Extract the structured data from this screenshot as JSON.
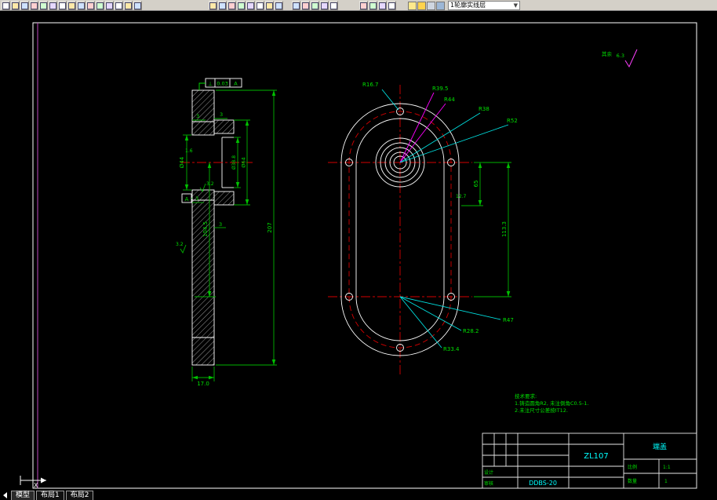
{
  "toolbar": {
    "groups": [
      {
        "name": "standard",
        "icons": [
          "new-file",
          "open-file",
          "save",
          "plot",
          "plot-preview",
          "spell-check",
          "cut",
          "copy",
          "paste",
          "match-properties",
          "undo",
          "redo",
          "insert-block",
          "table",
          "field"
        ]
      },
      {
        "name": "zoom",
        "icons": [
          "pan-realtime",
          "zoom-realtime",
          "zoom-window",
          "zoom-previous",
          "zoom-in",
          "zoom-out",
          "zoom-extents",
          "aerial-view"
        ]
      },
      {
        "name": "object-properties",
        "icons": [
          "layers",
          "layer-control",
          "color-control",
          "linetype",
          "lineweight"
        ]
      },
      {
        "name": "inquiry",
        "icons": [
          "distance",
          "area",
          "list",
          "locate-point"
        ]
      }
    ],
    "layer_combo": {
      "icons": [
        "layer-on",
        "layer-freeze",
        "layer-lock",
        "layer-plot"
      ],
      "value": "1轮廓实线层"
    }
  },
  "sheet": {
    "surface_finish_prefix": "其余",
    "surface_finish_value": "6.3"
  },
  "left_view": {
    "tolerance": {
      "symbol": "⊥",
      "value": "0.03",
      "datum": "A"
    },
    "datum_label": "A",
    "dims": {
      "top_3a": "3",
      "top_3b": "3",
      "neck_16": "1.6",
      "dia_44": "Ø44",
      "dia_388": "Ø38.8",
      "dia_64": "Ø64",
      "rough_32a": "3.2",
      "mid_3a": "3",
      "mid_3b": "3",
      "len_1045": "104.5",
      "len_207": "207",
      "rough_32b": "3.2",
      "thick_170": "17.0"
    }
  },
  "right_view": {
    "radius_labels": {
      "r167": "R16.7",
      "r395": "R39.5",
      "r44": "R44",
      "r38": "R38",
      "r52": "R52",
      "r47": "R47",
      "r282": "R28.2",
      "r334": "R33.4"
    },
    "dims": {
      "d127": "12.7",
      "d65": "65",
      "d1133": "113.3"
    }
  },
  "notes": {
    "title": "技术要求:",
    "line1": "1.铸造圆角R2, 未注倒角C0.5-1.",
    "line2": "2.未注尺寸公差按IT12."
  },
  "title_block": {
    "material": "ZL107",
    "drawing_no": "DDBS-20",
    "part_name": "端盖",
    "labels": {
      "design": "设计",
      "check": "审核",
      "scale": "比例",
      "qty": "数量"
    },
    "values": {
      "scale": "1:1",
      "qty": "1"
    }
  },
  "status_bar": {
    "tabs": [
      {
        "label": "模型"
      },
      {
        "label": "布局1"
      },
      {
        "label": "布局2"
      }
    ]
  },
  "ucs": {
    "x_label": "X"
  }
}
